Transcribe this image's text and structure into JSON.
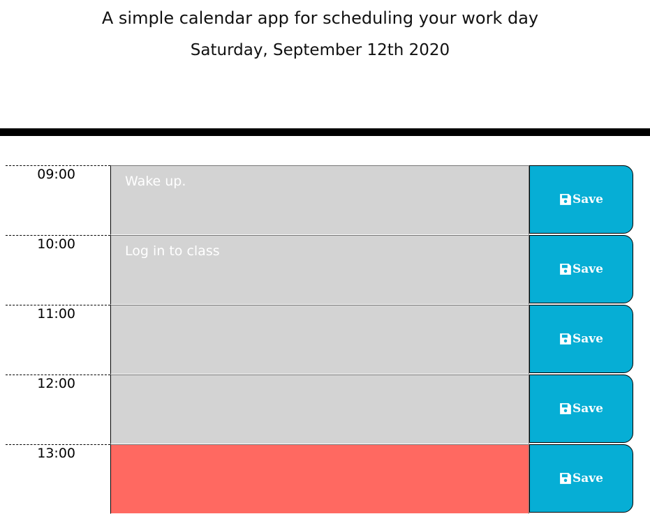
{
  "header": {
    "subtitle": "A simple calendar app for scheduling your work day",
    "current_day": "Saturday, September 12th 2020"
  },
  "save_label": "Save",
  "rows": [
    {
      "hour": "09:00",
      "text": "Wake up.",
      "state": "past"
    },
    {
      "hour": "10:00",
      "text": "Log in to class",
      "state": "past"
    },
    {
      "hour": "11:00",
      "text": "",
      "state": "past"
    },
    {
      "hour": "12:00",
      "text": "",
      "state": "past"
    },
    {
      "hour": "13:00",
      "text": "",
      "state": "present"
    }
  ],
  "colors": {
    "past": "#d3d3d3",
    "present": "#ff6961",
    "save_button": "#06aed5",
    "divider": "#000000"
  },
  "icons": {
    "save": "floppy-disk-icon"
  }
}
